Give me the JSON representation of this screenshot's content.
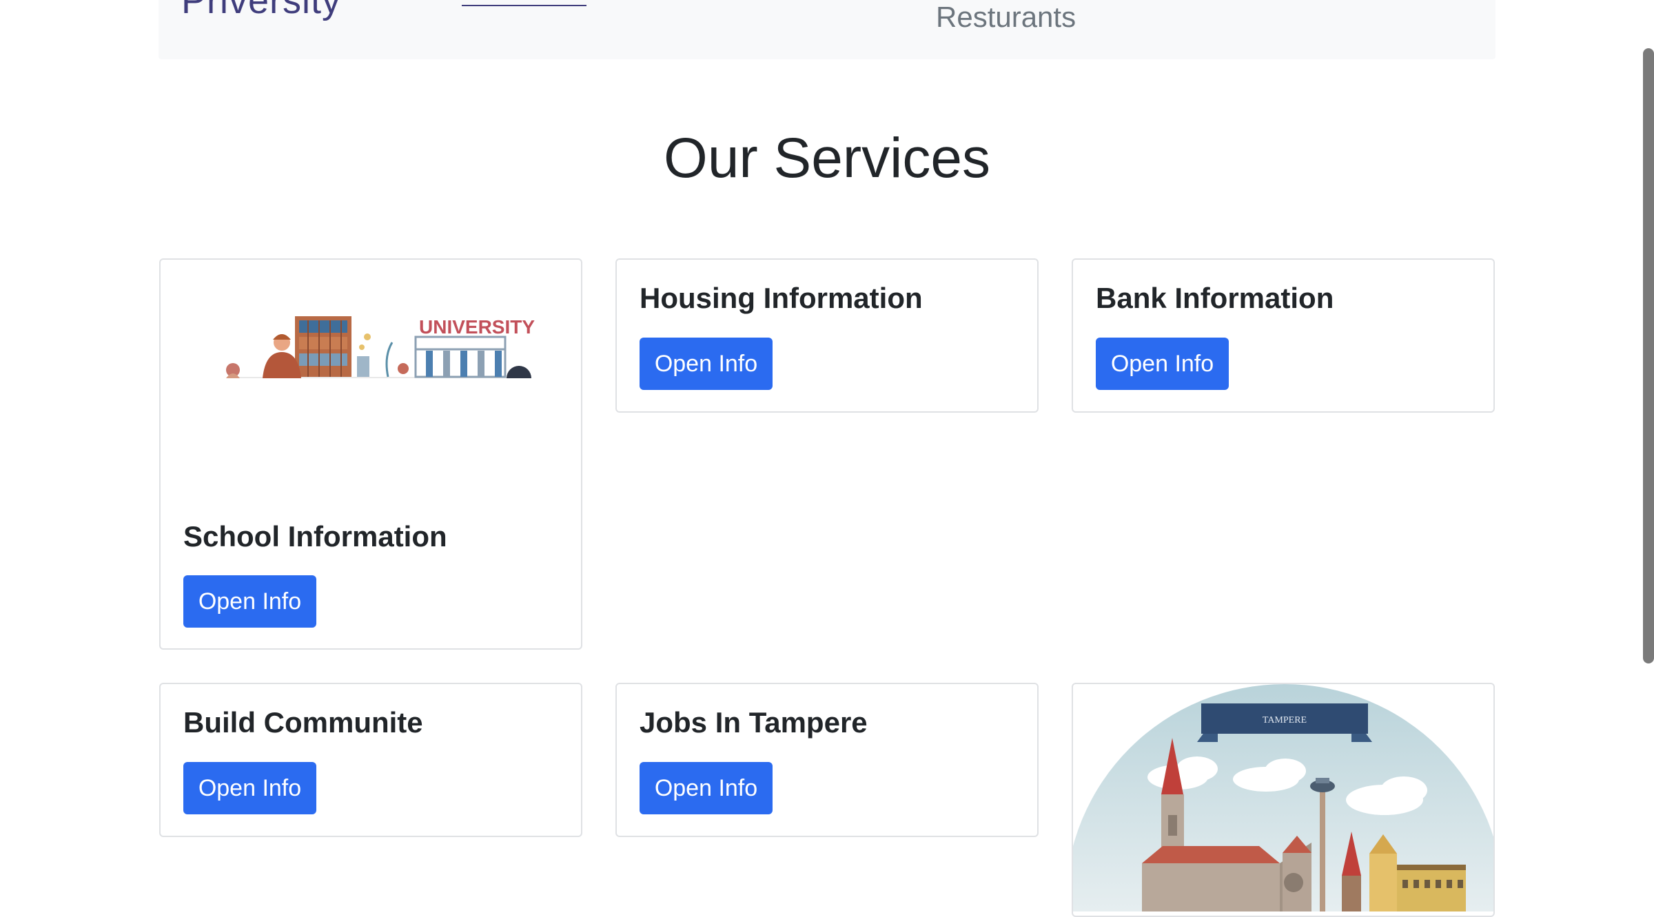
{
  "navbar": {
    "brand": "Priversity",
    "links": [
      "Resturants"
    ]
  },
  "main": {
    "title": "Our Services",
    "cards": [
      {
        "title": "School Information",
        "button": "Open Info",
        "image_caption": "UNIVERSITY"
      },
      {
        "title": "Housing Information",
        "button": "Open Info"
      },
      {
        "title": "Bank Information",
        "button": "Open Info"
      },
      {
        "title": "Build Communite",
        "button": "Open Info"
      },
      {
        "title": "Jobs In Tampere",
        "button": "Open Info"
      },
      {
        "image_caption": "TAMPERE"
      }
    ]
  },
  "colors": {
    "accent": "#2b6bf0",
    "brand": "#3f3d7c",
    "navbar_bg": "#f8f9fa",
    "card_border": "#dfe1e4"
  },
  "icons": [
    "university-illustration",
    "tampere-city-illustration"
  ]
}
